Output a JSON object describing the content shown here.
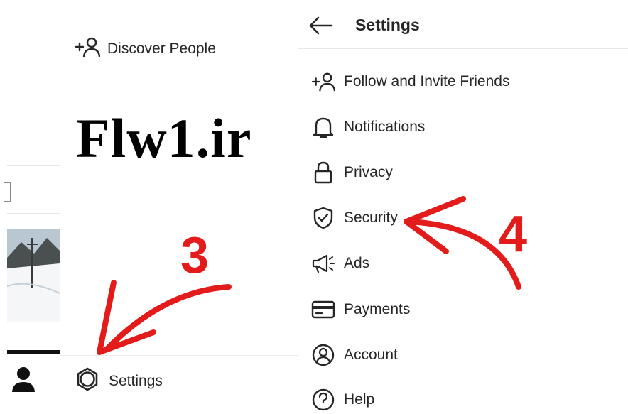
{
  "drawer": {
    "discover_label": "Discover People",
    "watermark": "Flw1.ir",
    "settings_label": "Settings"
  },
  "settings_screen": {
    "title": "Settings",
    "items": [
      {
        "label": "Follow and Invite Friends",
        "icon": "add-person-icon"
      },
      {
        "label": "Notifications",
        "icon": "bell-icon"
      },
      {
        "label": "Privacy",
        "icon": "lock-icon"
      },
      {
        "label": "Security",
        "icon": "shield-check-icon"
      },
      {
        "label": "Ads",
        "icon": "megaphone-icon"
      },
      {
        "label": "Payments",
        "icon": "card-icon"
      },
      {
        "label": "Account",
        "icon": "account-circle-icon"
      },
      {
        "label": "Help",
        "icon": "help-circle-icon"
      }
    ]
  },
  "annotations": {
    "step_3": "3",
    "step_4": "4",
    "color": "#e31b1b"
  }
}
